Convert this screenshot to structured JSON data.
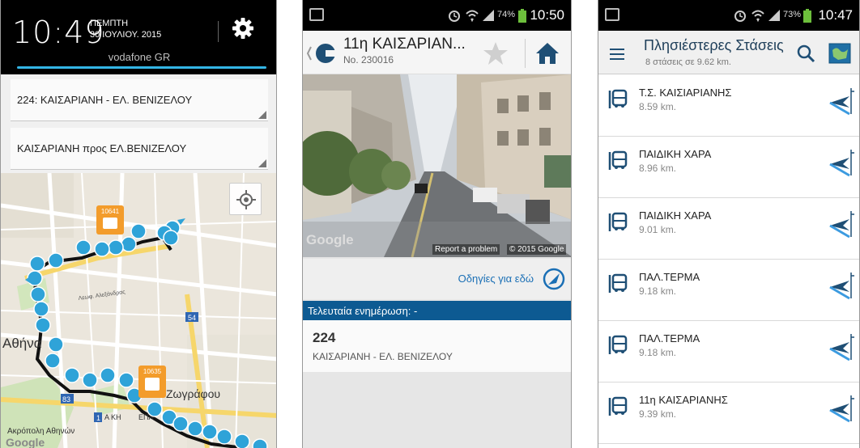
{
  "phone1": {
    "time": "10:49",
    "weekday": "ΠΕΜΠΤΗ",
    "date": "30 ΙΟΥΛΙΟΥ. 2015",
    "carrier": "vodafone GR",
    "route_select": "224: ΚΑΙΣΑΡΙΑΝΗ - ΕΛ. ΒΕΝΙΖΕΛΟΥ",
    "direction_select": "ΚΑΙΣΑΡΙΑΝΗ προς ΕΛ.ΒΕΝΙΖΕΛΟΥ",
    "map": {
      "vehicle_ids": [
        "10641",
        "10635"
      ],
      "labels": {
        "athens": "Αθήνα",
        "zografou": "Ζωγράφου",
        "acropolis": "Ακρόπολη Αθηνών",
        "google": "Google",
        "street_alexandras": "Λεωφ. Αλεξάνδρας",
        "road_54": "54",
        "road_83": "83",
        "road_1": "1",
        "ak_label": "Α ΚΗ",
        "ena_label": "ΕΠΑ"
      }
    }
  },
  "phone2": {
    "battery_pct": "74%",
    "clock": "10:50",
    "title": "11η ΚΑΙΣΑΡΙΑΝ...",
    "stop_number": "No. 230016",
    "photo_credit_google": "Google",
    "report_problem": "Report a problem",
    "copyright": "© 2015 Google",
    "directions_label": "Οδηγίες για εδώ",
    "last_update": "Τελευταία ενημέρωση: -",
    "route_number": "224",
    "route_description": "ΚΑΙΣΑΡΙΑΝΗ - ΕΛ. ΒΕΝΙΖΕΛΟΥ"
  },
  "phone3": {
    "battery_pct": "73%",
    "clock": "10:47",
    "title": "Πλησιέστερες Στάσεις",
    "subtitle": "8 στάσεις σε 9.62 km.",
    "stops": [
      {
        "name": "Τ.Σ. ΚΑΙΣΙΑΡΙΑΝΗΣ",
        "distance": "8.59 km."
      },
      {
        "name": "ΠΑΙΔΙΚΗ ΧΑΡΑ",
        "distance": "8.96 km."
      },
      {
        "name": "ΠΑΙΔΙΚΗ ΧΑΡΑ",
        "distance": "9.01 km."
      },
      {
        "name": "ΠΑΛ.ΤΕΡΜΑ",
        "distance": "9.18 km."
      },
      {
        "name": "ΠΑΛ.ΤΕΡΜΑ",
        "distance": "9.18 km."
      },
      {
        "name": "11η ΚΑΙΣΑΡΙΑΝΗΣ",
        "distance": "9.39 km."
      }
    ]
  },
  "colors": {
    "accent_blue": "#33b5e5",
    "stop_marker": "#2fa3d8",
    "vehicle_marker": "#f39c2b",
    "update_bar": "#0d5a92",
    "link_blue": "#1a6fb5"
  }
}
